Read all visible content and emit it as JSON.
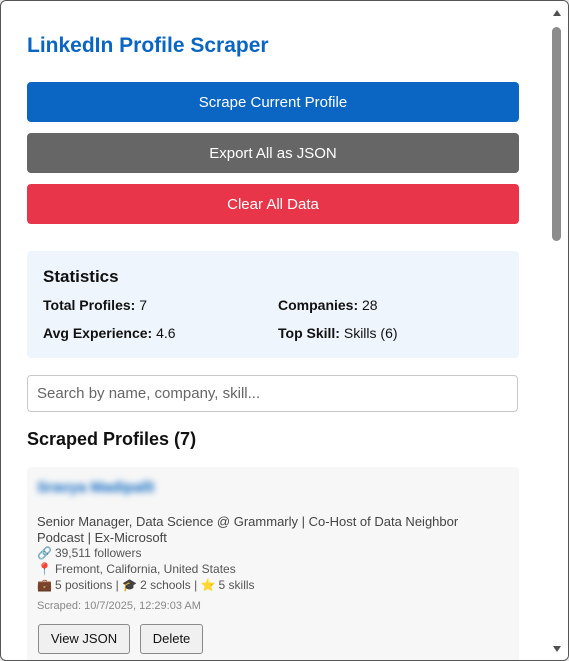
{
  "header": {
    "title": "LinkedIn Profile Scraper"
  },
  "actions": {
    "scrape_label": "Scrape Current Profile",
    "export_label": "Export All as JSON",
    "clear_label": "Clear All Data"
  },
  "stats": {
    "title": "Statistics",
    "total_profiles_label": "Total Profiles:",
    "total_profiles_value": "7",
    "companies_label": "Companies:",
    "companies_value": "28",
    "avg_experience_label": "Avg Experience:",
    "avg_experience_value": "4.6",
    "top_skill_label": "Top Skill:",
    "top_skill_value": "Skills (6)"
  },
  "search": {
    "placeholder": "Search by name, company, skill..."
  },
  "profiles_section": {
    "title": "Scraped Profiles (7)"
  },
  "profiles": [
    {
      "name": "Sravya Madipalli",
      "headline": "Senior Manager, Data Science @ Grammarly | Co-Host of Data Neighbor Podcast | Ex-Microsoft",
      "followers": "39,511 followers",
      "location": "Fremont, California, United States",
      "positions": "5 positions",
      "schools": "2 schools",
      "skills": "5 skills",
      "scraped": "Scraped: 10/7/2025, 12:29:03 AM",
      "view_label": "View JSON",
      "delete_label": "Delete"
    }
  ],
  "icons": {
    "link": "🔗",
    "location": "📍",
    "briefcase": "💼",
    "graduation": "🎓",
    "star": "⭐",
    "separator": " | "
  },
  "colors": {
    "brand": "#0a66c2",
    "export": "#666666",
    "danger": "#e8354a",
    "stats_bg": "#eef5fc"
  }
}
